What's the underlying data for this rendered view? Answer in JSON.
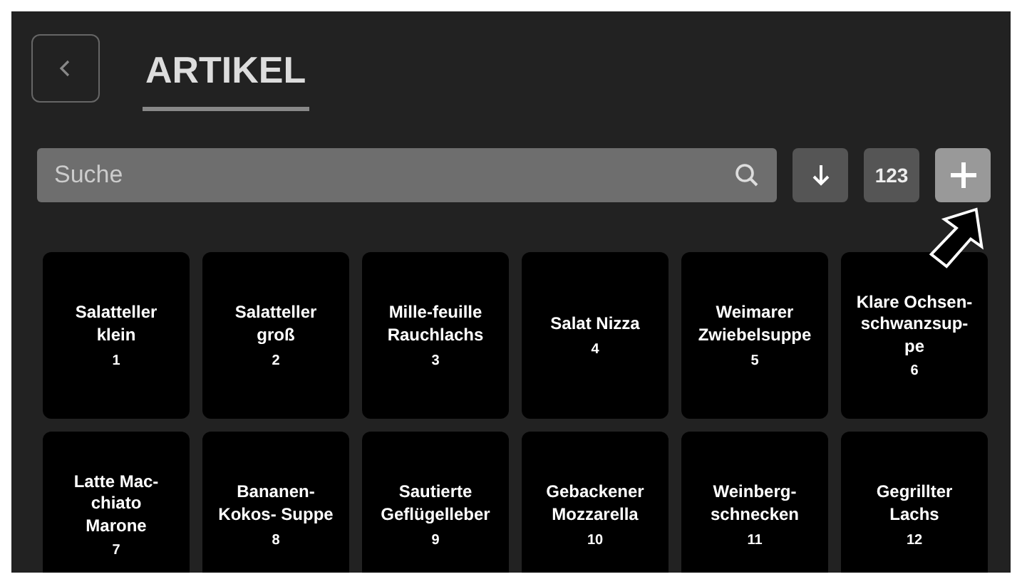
{
  "header": {
    "title": "ARTIKEL"
  },
  "search": {
    "placeholder": "Suche"
  },
  "toolbar": [
    {
      "kind": "sort",
      "highlighted": false
    },
    {
      "kind": "text",
      "label": "123",
      "highlighted": false
    },
    {
      "kind": "add",
      "highlighted": true
    }
  ],
  "articles": [
    {
      "name": "Salatteller\nklein",
      "number": "1"
    },
    {
      "name": "Salatteller\ngroß",
      "number": "2"
    },
    {
      "name": "Mille-feuille\nRauchlachs",
      "number": "3"
    },
    {
      "name": "Salat Nizza",
      "number": "4"
    },
    {
      "name": "Weimarer\nZwiebelsuppe",
      "number": "5"
    },
    {
      "name": "Klare Ochsen-\nschwanzsup-\npe",
      "number": "6"
    },
    {
      "name": "Latte Mac-\nchiato\nMarone",
      "number": "7"
    },
    {
      "name": "Bananen-\nKokos- Suppe",
      "number": "8"
    },
    {
      "name": "Sautierte\nGeflügelleber",
      "number": "9"
    },
    {
      "name": "Gebackener\nMozzarella",
      "number": "10"
    },
    {
      "name": "Weinberg-\nschnecken",
      "number": "11"
    },
    {
      "name": "Gegrillter\nLachs",
      "number": "12"
    }
  ]
}
